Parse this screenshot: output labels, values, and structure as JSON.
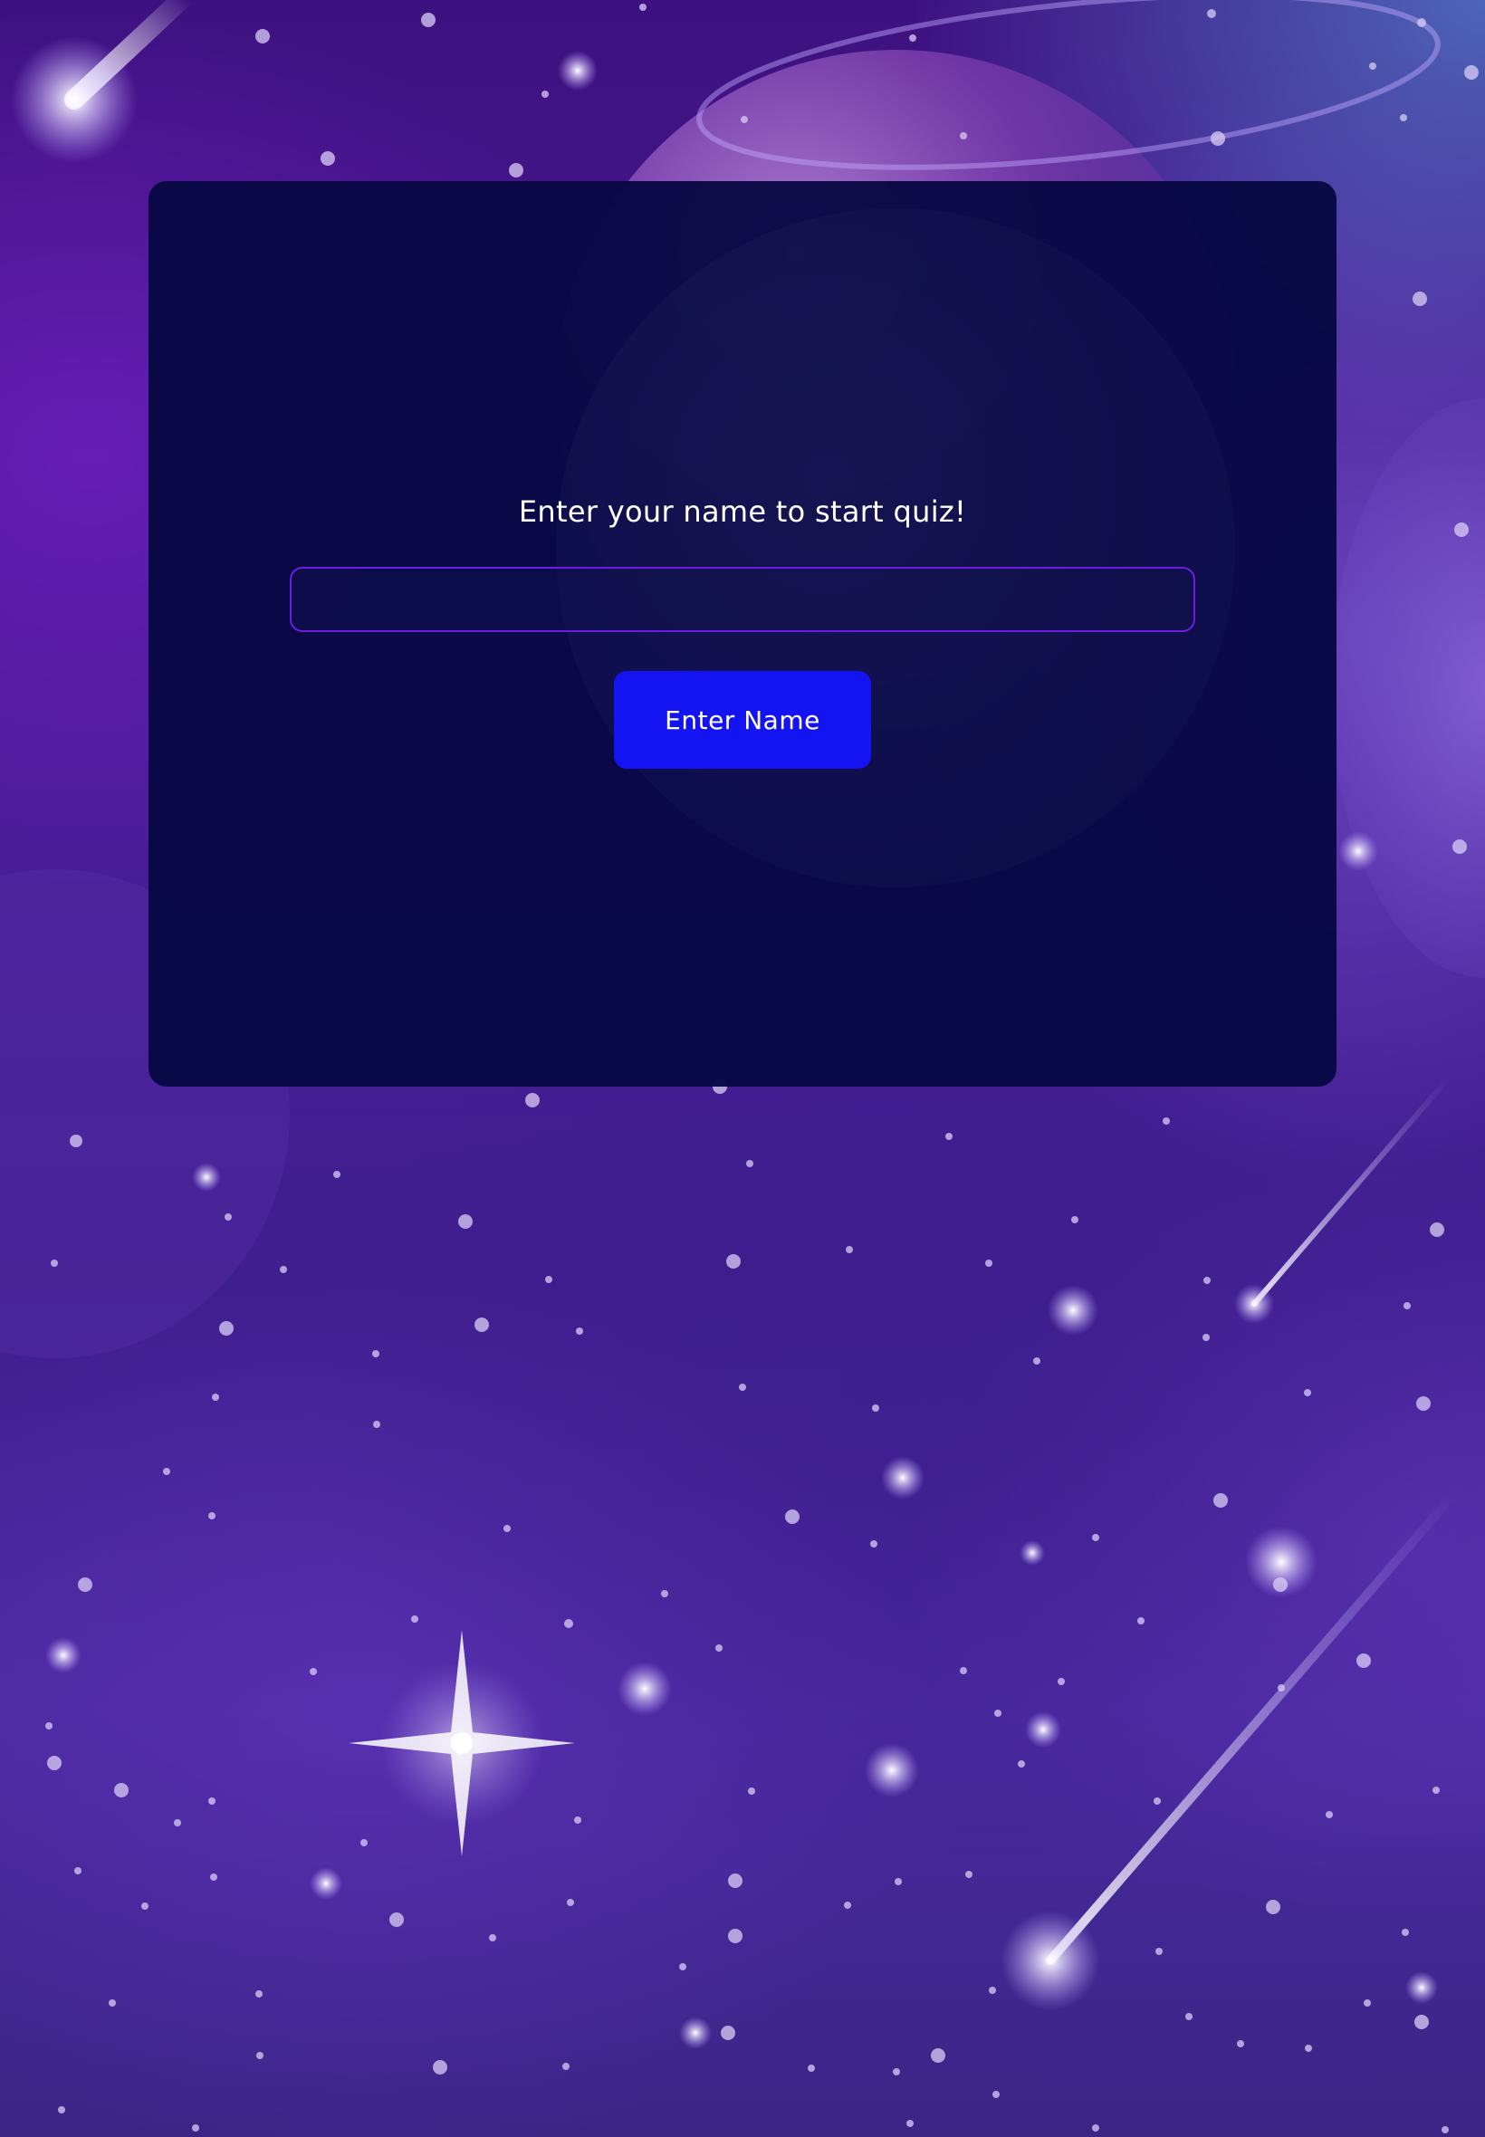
{
  "quiz": {
    "prompt": "Enter your name to start quiz!",
    "name_input_value": "",
    "name_input_placeholder": "",
    "submit_label": "Enter Name"
  },
  "colors": {
    "card_background": "#08084a",
    "input_border": "#6a1fe0",
    "button_background": "#1414f2",
    "text": "#ffffff"
  },
  "background": {
    "theme": "galaxy-night-sky",
    "elements": [
      "stars",
      "shooting-stars",
      "planet",
      "sparkle"
    ]
  }
}
